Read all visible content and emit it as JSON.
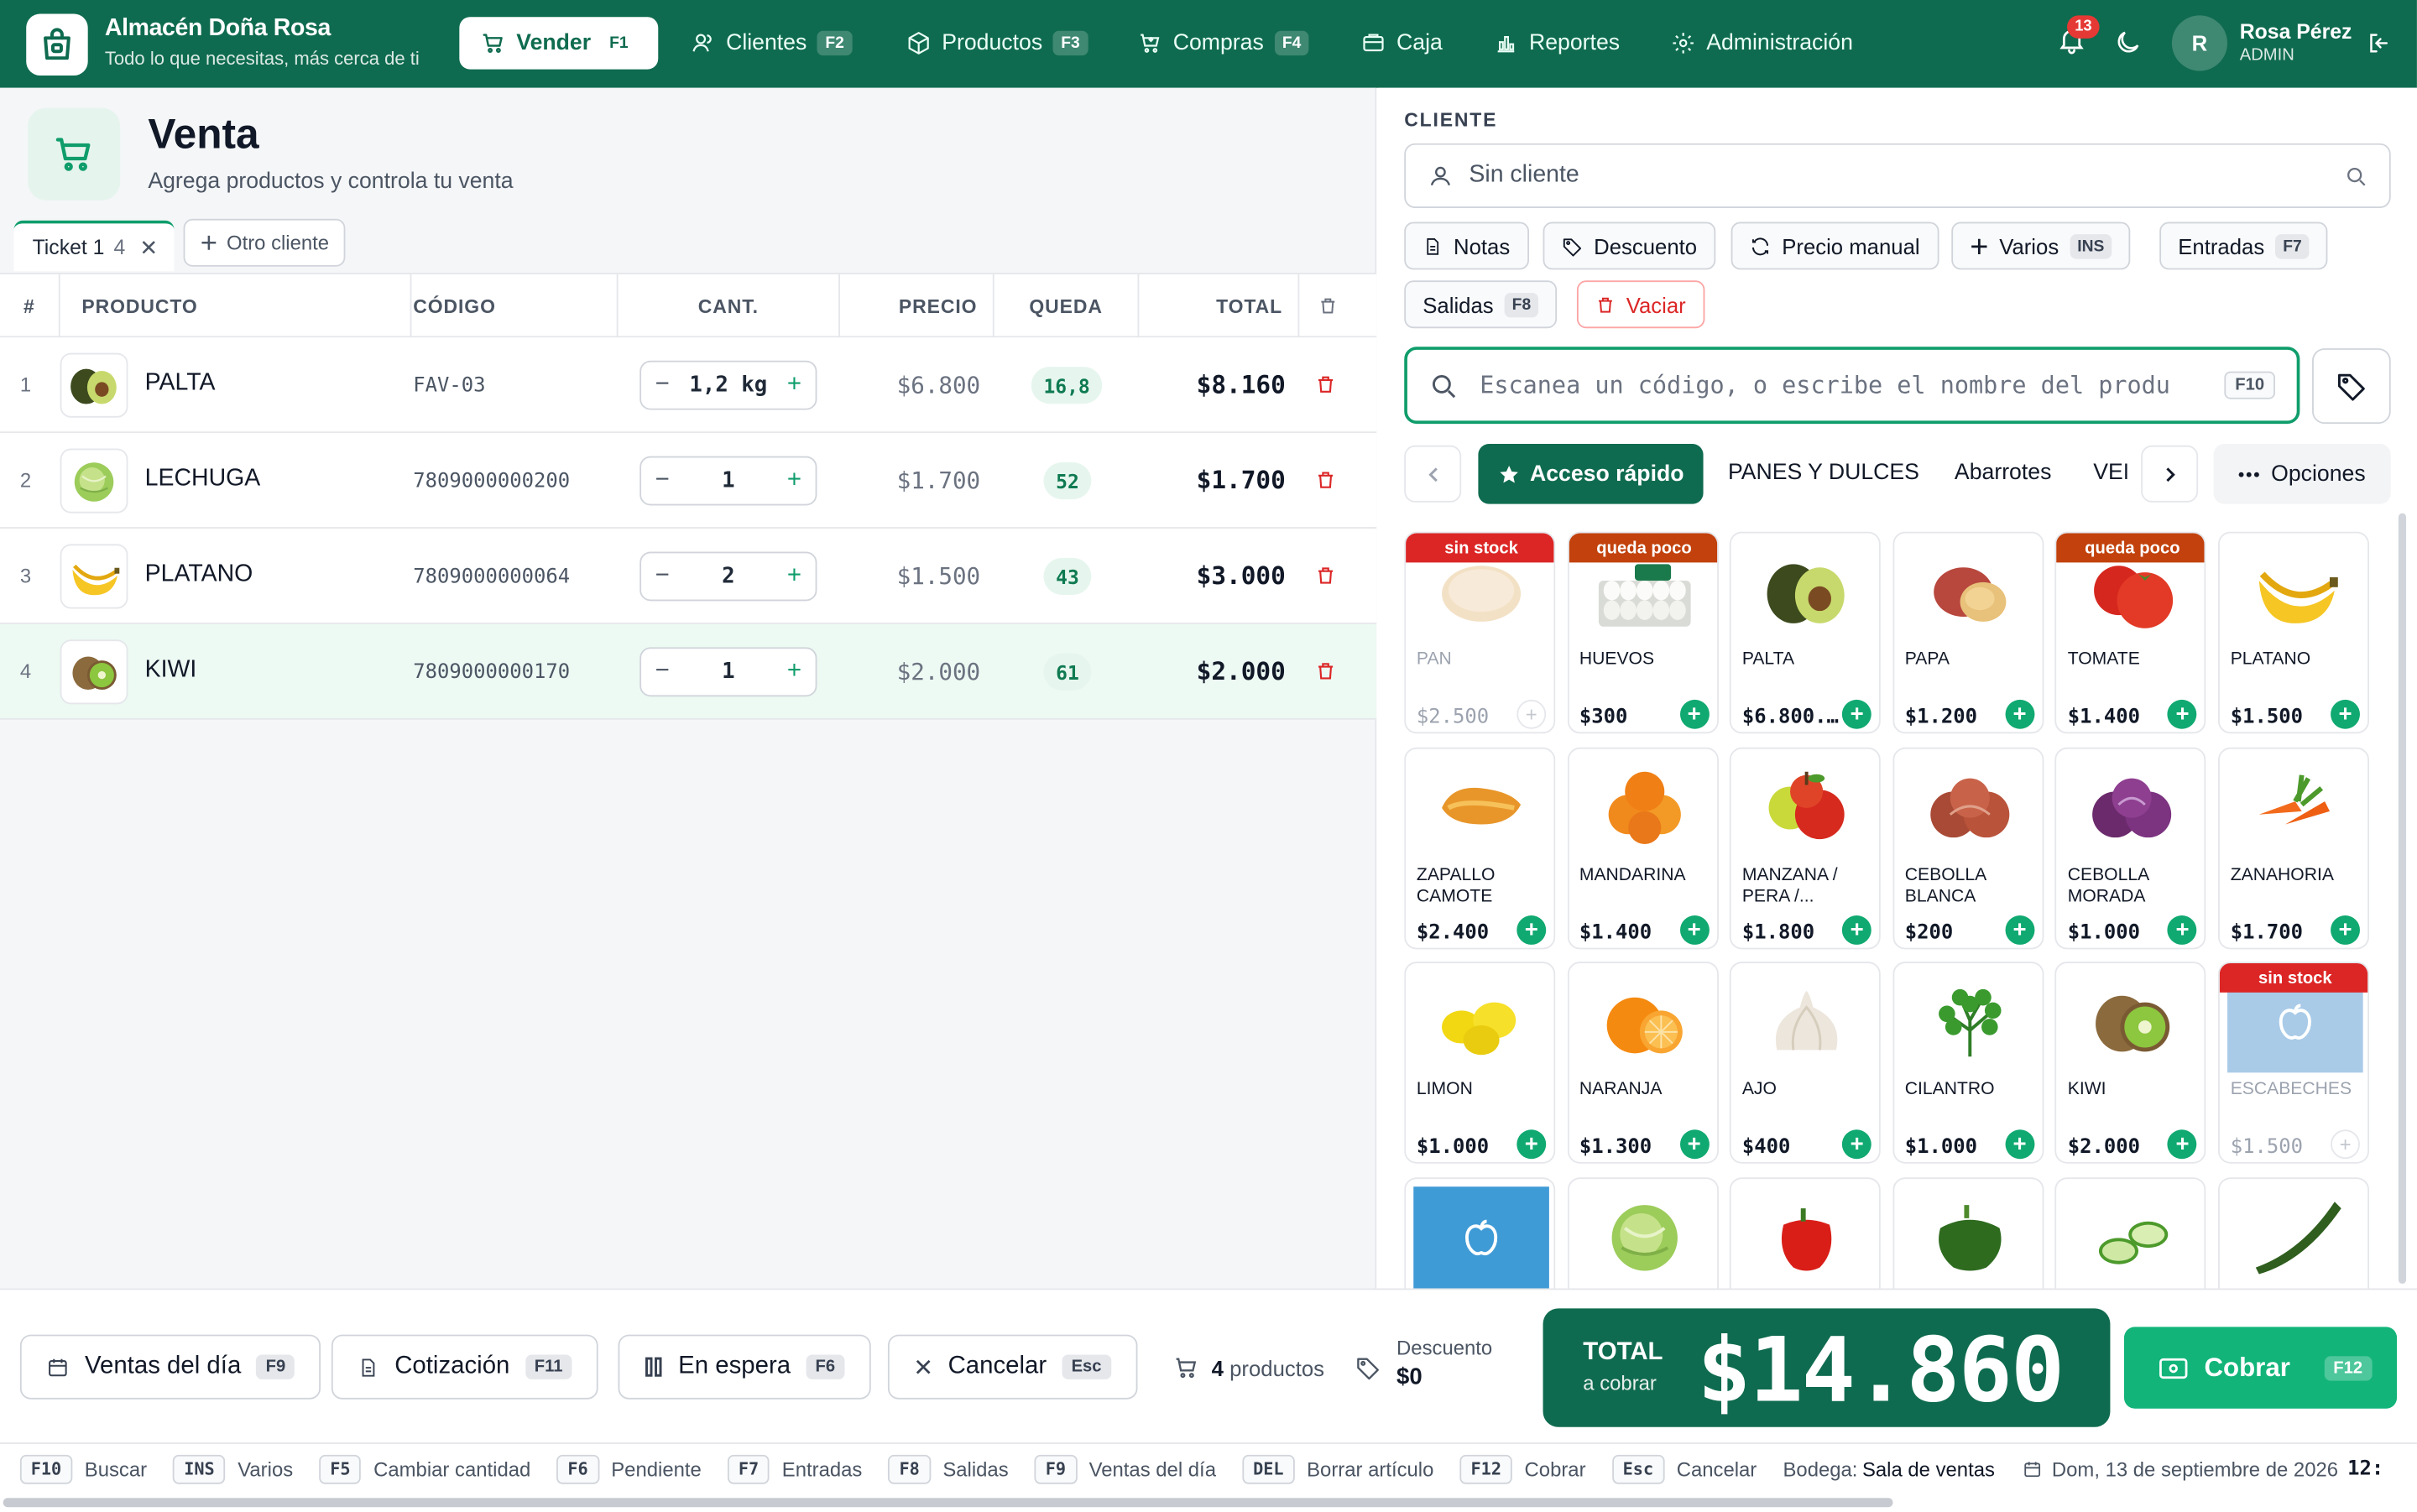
{
  "app": {
    "name": "Almacén Doña Rosa",
    "tagline": "Todo lo que necesitas, más cerca de ti"
  },
  "nav": [
    {
      "label": "Vender",
      "key": "F1",
      "icon": "cart-icon",
      "active": true
    },
    {
      "label": "Clientes",
      "key": "F2",
      "icon": "users-icon"
    },
    {
      "label": "Productos",
      "key": "F3",
      "icon": "box-icon"
    },
    {
      "label": "Compras",
      "key": "F4",
      "icon": "cart-down-icon"
    },
    {
      "label": "Caja",
      "key": "",
      "icon": "register-icon"
    },
    {
      "label": "Reportes",
      "key": "",
      "icon": "chart-icon"
    },
    {
      "label": "Administración",
      "key": "",
      "icon": "gear-icon"
    }
  ],
  "user": {
    "notifications": "13",
    "initial": "R",
    "name": "Rosa Pérez",
    "role": "ADMIN"
  },
  "page": {
    "title": "Venta",
    "subtitle": "Agrega productos y controla tu venta"
  },
  "tickets": {
    "tab_label": "Ticket 1",
    "tab_count": "4",
    "new_label": "Otro cliente"
  },
  "table": {
    "headers": {
      "num": "#",
      "product": "PRODUCTO",
      "code": "CÓDIGO",
      "qty": "CANT.",
      "price": "PRECIO",
      "left": "QUEDA",
      "total": "TOTAL"
    },
    "rows": [
      {
        "num": "1",
        "name": "PALTA",
        "code": "FAV-03",
        "qty": "1,2 kg",
        "price": "$6.800",
        "left": "16,8",
        "total": "$8.160",
        "img": "avocado"
      },
      {
        "num": "2",
        "name": "LECHUGA",
        "code": "7809000000200",
        "qty": "1",
        "price": "$1.700",
        "left": "52",
        "total": "$1.700",
        "img": "lettuce"
      },
      {
        "num": "3",
        "name": "PLATANO",
        "code": "7809000000064",
        "qty": "2",
        "price": "$1.500",
        "left": "43",
        "total": "$3.000",
        "img": "banana"
      },
      {
        "num": "4",
        "name": "KIWI",
        "code": "7809000000170",
        "qty": "1",
        "price": "$2.000",
        "left": "61",
        "total": "$2.000",
        "img": "kiwi"
      }
    ]
  },
  "client": {
    "label": "CLIENTE",
    "placeholder": "Sin cliente"
  },
  "actions": [
    {
      "label": "Notas",
      "key": ""
    },
    {
      "label": "Descuento",
      "key": ""
    },
    {
      "label": "Precio manual",
      "key": ""
    },
    {
      "label": "Varios",
      "key": "INS"
    },
    {
      "label": "Entradas",
      "key": "F7"
    },
    {
      "label": "Salidas",
      "key": "F8"
    },
    {
      "label": "Vaciar",
      "key": ""
    }
  ],
  "search": {
    "placeholder": "Escanea un código, o escribe el nombre del produ",
    "key": "F10"
  },
  "categories": {
    "quick": "Acceso rápido",
    "items": [
      "PANES Y DULCES",
      "Abarrotes",
      "VEI"
    ],
    "options": "Opciones"
  },
  "products": [
    {
      "name": "PAN",
      "price": "$2.500",
      "badge": "sin stock",
      "img": "bread",
      "dim": true
    },
    {
      "name": "HUEVOS",
      "price": "$300",
      "badge": "queda poco",
      "img": "eggs"
    },
    {
      "name": "PALTA",
      "price": "$6.800...",
      "badge": "",
      "img": "avocado"
    },
    {
      "name": "PAPA",
      "price": "$1.200",
      "badge": "",
      "img": "potato"
    },
    {
      "name": "TOMATE",
      "price": "$1.400",
      "badge": "queda poco",
      "img": "tomato"
    },
    {
      "name": "PLATANO",
      "price": "$1.500",
      "badge": "",
      "img": "banana"
    },
    {
      "name": "ZAPALLO CAMOTE",
      "price": "$2.400",
      "badge": "",
      "img": "squash"
    },
    {
      "name": "MANDARINA",
      "price": "$1.400",
      "badge": "",
      "img": "mandarin"
    },
    {
      "name": "MANZANA / PERA /...",
      "price": "$1.800",
      "badge": "",
      "img": "apple"
    },
    {
      "name": "CEBOLLA BLANCA",
      "price": "$200",
      "badge": "",
      "img": "onion"
    },
    {
      "name": "CEBOLLA MORADA",
      "price": "$1.000",
      "badge": "",
      "img": "red-onion"
    },
    {
      "name": "ZANAHORIA",
      "price": "$1.700",
      "badge": "",
      "img": "carrot"
    },
    {
      "name": "LIMON",
      "price": "$1.000",
      "badge": "",
      "img": "lemon"
    },
    {
      "name": "NARANJA",
      "price": "$1.300",
      "badge": "",
      "img": "orange"
    },
    {
      "name": "AJO",
      "price": "$400",
      "badge": "",
      "img": "garlic"
    },
    {
      "name": "CILANTRO",
      "price": "$1.000",
      "badge": "",
      "img": "cilantro"
    },
    {
      "name": "KIWI",
      "price": "$2.000",
      "badge": "",
      "img": "kiwi"
    },
    {
      "name": "ESCABECHES",
      "price": "$1.500",
      "badge": "sin stock",
      "img": "placeholder",
      "dim": true
    },
    {
      "name": "",
      "price": "",
      "badge": "",
      "img": "placeholder-blue"
    },
    {
      "name": "",
      "price": "",
      "badge": "",
      "img": "lettuce"
    },
    {
      "name": "",
      "price": "",
      "badge": "",
      "img": "pepper"
    },
    {
      "name": "",
      "price": "",
      "badge": "",
      "img": "green-pepper"
    },
    {
      "name": "",
      "price": "",
      "badge": "",
      "img": "cucumber"
    },
    {
      "name": "",
      "price": "",
      "badge": "",
      "img": "zucchini"
    }
  ],
  "bottom": {
    "buttons": [
      {
        "label": "Ventas del día",
        "key": "F9"
      },
      {
        "label": "Cotización",
        "key": "F11"
      },
      {
        "label": "En espera",
        "key": "F6"
      },
      {
        "label": "Cancelar",
        "key": "Esc"
      }
    ],
    "product_count": "4",
    "product_count_suffix": "productos",
    "discount_label": "Descuento",
    "discount_value": "$0",
    "total_label": "TOTAL",
    "total_sub": "a cobrar",
    "total_value": "$14.860",
    "pay_label": "Cobrar",
    "pay_key": "F12"
  },
  "shortcuts": [
    {
      "key": "F10",
      "label": "Buscar"
    },
    {
      "key": "INS",
      "label": "Varios"
    },
    {
      "key": "F5",
      "label": "Cambiar cantidad"
    },
    {
      "key": "F6",
      "label": "Pendiente"
    },
    {
      "key": "F7",
      "label": "Entradas"
    },
    {
      "key": "F8",
      "label": "Salidas"
    },
    {
      "key": "F9",
      "label": "Ventas del día"
    },
    {
      "key": "DEL",
      "label": "Borrar artículo"
    },
    {
      "key": "F12",
      "label": "Cobrar"
    },
    {
      "key": "Esc",
      "label": "Cancelar"
    }
  ],
  "status": {
    "warehouse_label": "Bodega:",
    "warehouse": "Sala de ventas",
    "date": "Dom, 13 de septiembre de 2026",
    "time": "12:"
  },
  "colors": {
    "brand": "#0f6b4f",
    "accent": "#12b47a",
    "danger": "#dc2626",
    "low_stock": "#c2410c",
    "no_stock": "#dc2626"
  }
}
